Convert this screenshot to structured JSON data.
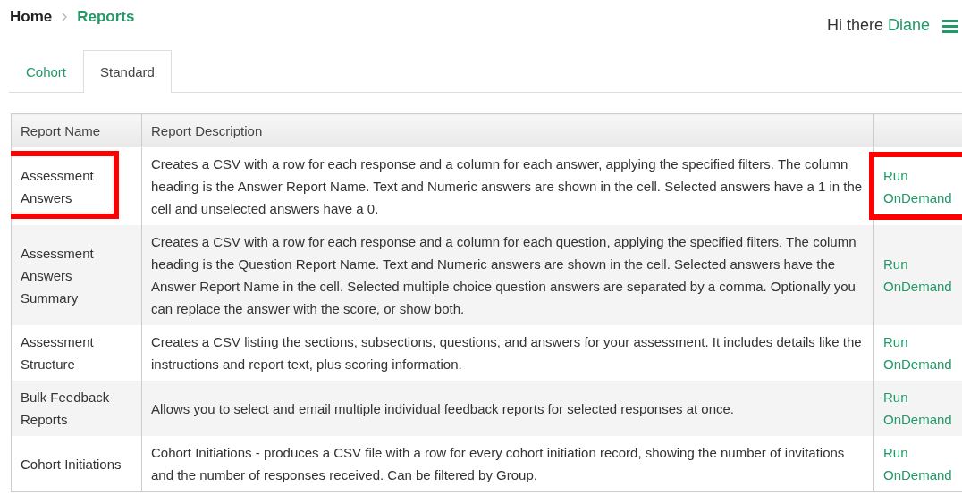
{
  "breadcrumb": [
    {
      "label": "Home",
      "current": false
    },
    {
      "label": "Reports",
      "current": true
    }
  ],
  "greeting": {
    "text": "Hi there",
    "user": "Diane"
  },
  "tabs": [
    {
      "label": "Cohort",
      "selected": false
    },
    {
      "label": "Standard",
      "selected": true
    }
  ],
  "table": {
    "columns": [
      "Report Name",
      "Report Description"
    ],
    "rows": [
      {
        "name": "Assessment Answers",
        "description": "Creates a CSV with a row for each response and a column for each answer, applying the specified filters. The column heading is the Answer Report Name. Text and Numeric answers are shown in the cell. Selected answers have a 1 in the cell and unselected answers have a 0.",
        "action": "Run OnDemand",
        "name_highlighted": true,
        "action_highlighted": true
      },
      {
        "name": "Assessment Answers Summary",
        "description": "Creates a CSV with a row for each response and a column for each question, applying the specified filters. The column heading is the Question Report Name. Text and Numeric answers are shown in the cell. Selected answers have the Answer Report Name in the cell. Selected multiple choice question answers are separated by a comma. Optionally you can replace the answer with the score, or show both.",
        "action": "Run OnDemand",
        "name_highlighted": false,
        "action_highlighted": false
      },
      {
        "name": "Assessment Structure",
        "description": "Creates a CSV listing the sections, subsections, questions, and answers for your assessment. It includes details like the instructions and report text, plus scoring information.",
        "action": "Run OnDemand",
        "name_highlighted": false,
        "action_highlighted": false
      },
      {
        "name": "Bulk Feedback Reports",
        "description": "Allows you to select and email multiple individual feedback reports for selected responses at once.",
        "action": "Run OnDemand",
        "name_highlighted": false,
        "action_highlighted": false
      },
      {
        "name": "Cohort Initiations",
        "description": "Cohort Initiations - produces a CSV file with a row for every cohort initiation record, showing the number of invitations and the number of responses received. Can be filtered by Group.",
        "action": "Run OnDemand",
        "name_highlighted": false,
        "action_highlighted": false
      }
    ]
  }
}
